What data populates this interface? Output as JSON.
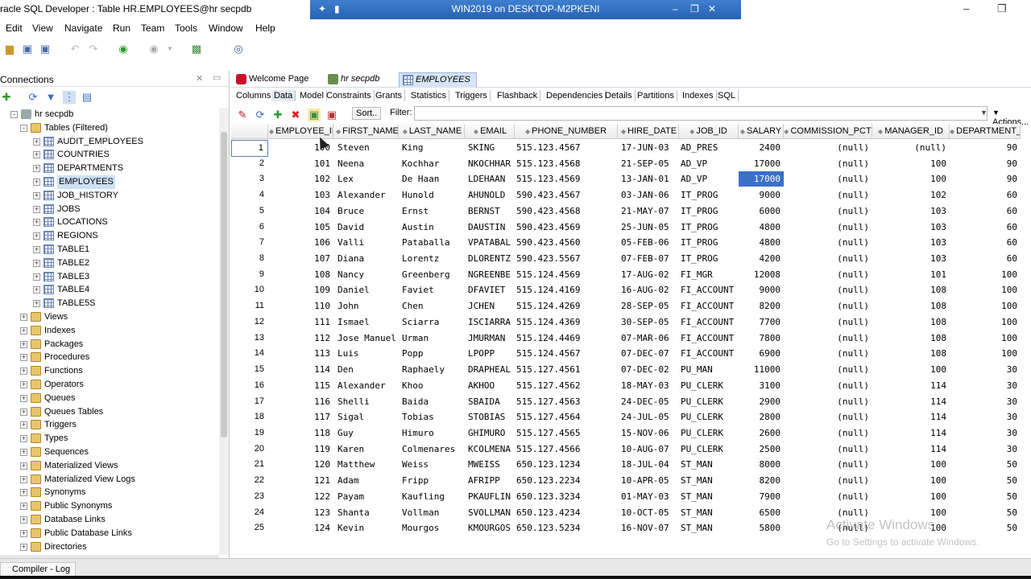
{
  "window": {
    "title": "racle SQL Developer : Table HR.EMPLOYEES@hr secpdb",
    "rdp_title": "WIN2019 on DESKTOP-M2PKENI"
  },
  "menu": [
    "Edit",
    "View",
    "Navigate",
    "Run",
    "Team",
    "Tools",
    "Window",
    "Help"
  ],
  "connections": {
    "title": "Connections",
    "tree": [
      {
        "label": "hr secpdb",
        "level": 0,
        "icon": "db",
        "exp": "-"
      },
      {
        "label": "Tables (Filtered)",
        "level": 1,
        "icon": "folder",
        "exp": "-"
      },
      {
        "label": "AUDIT_EMPLOYEES",
        "level": 2,
        "icon": "table",
        "exp": "+"
      },
      {
        "label": "COUNTRIES",
        "level": 2,
        "icon": "table",
        "exp": "+"
      },
      {
        "label": "DEPARTMENTS",
        "level": 2,
        "icon": "table",
        "exp": "+"
      },
      {
        "label": "EMPLOYEES",
        "level": 2,
        "icon": "table",
        "exp": "+",
        "selected": true
      },
      {
        "label": "JOB_HISTORY",
        "level": 2,
        "icon": "table",
        "exp": "+"
      },
      {
        "label": "JOBS",
        "level": 2,
        "icon": "table",
        "exp": "+"
      },
      {
        "label": "LOCATIONS",
        "level": 2,
        "icon": "table",
        "exp": "+"
      },
      {
        "label": "REGIONS",
        "level": 2,
        "icon": "table",
        "exp": "+"
      },
      {
        "label": "TABLE1",
        "level": 2,
        "icon": "table",
        "exp": "+"
      },
      {
        "label": "TABLE2",
        "level": 2,
        "icon": "table",
        "exp": "+"
      },
      {
        "label": "TABLE3",
        "level": 2,
        "icon": "table",
        "exp": "+"
      },
      {
        "label": "TABLE4",
        "level": 2,
        "icon": "table",
        "exp": "+"
      },
      {
        "label": "TABLE5S",
        "level": 2,
        "icon": "table",
        "exp": "+"
      },
      {
        "label": "Views",
        "level": 1,
        "icon": "folder",
        "exp": "+"
      },
      {
        "label": "Indexes",
        "level": 1,
        "icon": "folder",
        "exp": "+"
      },
      {
        "label": "Packages",
        "level": 1,
        "icon": "folder",
        "exp": "+"
      },
      {
        "label": "Procedures",
        "level": 1,
        "icon": "folder",
        "exp": "+"
      },
      {
        "label": "Functions",
        "level": 1,
        "icon": "folder",
        "exp": "+"
      },
      {
        "label": "Operators",
        "level": 1,
        "icon": "folder",
        "exp": "+"
      },
      {
        "label": "Queues",
        "level": 1,
        "icon": "folder",
        "exp": "+"
      },
      {
        "label": "Queues Tables",
        "level": 1,
        "icon": "folder",
        "exp": "+"
      },
      {
        "label": "Triggers",
        "level": 1,
        "icon": "folder",
        "exp": "+"
      },
      {
        "label": "Types",
        "level": 1,
        "icon": "folder",
        "exp": "+"
      },
      {
        "label": "Sequences",
        "level": 1,
        "icon": "folder",
        "exp": "+"
      },
      {
        "label": "Materialized Views",
        "level": 1,
        "icon": "folder",
        "exp": "+"
      },
      {
        "label": "Materialized View Logs",
        "level": 1,
        "icon": "folder",
        "exp": "+"
      },
      {
        "label": "Synonyms",
        "level": 1,
        "icon": "folder",
        "exp": "+"
      },
      {
        "label": "Public Synonyms",
        "level": 1,
        "icon": "folder",
        "exp": "+"
      },
      {
        "label": "Database Links",
        "level": 1,
        "icon": "folder",
        "exp": "+"
      },
      {
        "label": "Public Database Links",
        "level": 1,
        "icon": "folder",
        "exp": "+"
      },
      {
        "label": "Directories",
        "level": 1,
        "icon": "folder",
        "exp": "+"
      }
    ]
  },
  "doc_tabs": [
    {
      "label": "Welcome Page",
      "icon": "oracle-icon",
      "active": false
    },
    {
      "label": "hr secpdb",
      "icon": "sql-worksheet-icon",
      "active": false
    },
    {
      "label": "EMPLOYEES",
      "icon": "table-icon",
      "active": true
    }
  ],
  "sub_tabs": [
    "Columns",
    "Data",
    "Model",
    "Constraints",
    "Grants",
    "Statistics",
    "Triggers",
    "Flashback",
    "Dependencies",
    "Details",
    "Partitions",
    "Indexes",
    "SQL"
  ],
  "active_sub_tab": "Data",
  "grid_toolbar": {
    "sort_label": "Sort..",
    "filter_label": "Filter:",
    "filter_value": "",
    "actions_label": "Actions..."
  },
  "grid": {
    "columns": [
      "EMPLOYEE_ID",
      "FIRST_NAME",
      "LAST_NAME",
      "EMAIL",
      "PHONE_NUMBER",
      "HIRE_DATE",
      "JOB_ID",
      "SALARY",
      "COMMISSION_PCT",
      "MANAGER_ID",
      "DEPARTMENT_ID"
    ],
    "rows": [
      [
        "1",
        "100",
        "Steven",
        "King",
        "SKING",
        "515.123.4567",
        "17-JUN-03",
        "AD_PRES",
        "2400",
        "(null)",
        "(null)",
        "90"
      ],
      [
        "2",
        "101",
        "Neena",
        "Kochhar",
        "NKOCHHAR",
        "515.123.4568",
        "21-SEP-05",
        "AD_VP",
        "17000",
        "(null)",
        "100",
        "90"
      ],
      [
        "3",
        "102",
        "Lex",
        "De Haan",
        "LDEHAAN",
        "515.123.4569",
        "13-JAN-01",
        "AD_VP",
        "17000",
        "(null)",
        "100",
        "90"
      ],
      [
        "4",
        "103",
        "Alexander",
        "Hunold",
        "AHUNOLD",
        "590.423.4567",
        "03-JAN-06",
        "IT_PROG",
        "9000",
        "(null)",
        "102",
        "60"
      ],
      [
        "5",
        "104",
        "Bruce",
        "Ernst",
        "BERNST",
        "590.423.4568",
        "21-MAY-07",
        "IT_PROG",
        "6000",
        "(null)",
        "103",
        "60"
      ],
      [
        "6",
        "105",
        "David",
        "Austin",
        "DAUSTIN",
        "590.423.4569",
        "25-JUN-05",
        "IT_PROG",
        "4800",
        "(null)",
        "103",
        "60"
      ],
      [
        "7",
        "106",
        "Valli",
        "Pataballa",
        "VPATABAL",
        "590.423.4560",
        "05-FEB-06",
        "IT_PROG",
        "4800",
        "(null)",
        "103",
        "60"
      ],
      [
        "8",
        "107",
        "Diana",
        "Lorentz",
        "DLORENTZ",
        "590.423.5567",
        "07-FEB-07",
        "IT_PROG",
        "4200",
        "(null)",
        "103",
        "60"
      ],
      [
        "9",
        "108",
        "Nancy",
        "Greenberg",
        "NGREENBE",
        "515.124.4569",
        "17-AUG-02",
        "FI_MGR",
        "12008",
        "(null)",
        "101",
        "100"
      ],
      [
        "10",
        "109",
        "Daniel",
        "Faviet",
        "DFAVIET",
        "515.124.4169",
        "16-AUG-02",
        "FI_ACCOUNT",
        "9000",
        "(null)",
        "108",
        "100"
      ],
      [
        "11",
        "110",
        "John",
        "Chen",
        "JCHEN",
        "515.124.4269",
        "28-SEP-05",
        "FI_ACCOUNT",
        "8200",
        "(null)",
        "108",
        "100"
      ],
      [
        "12",
        "111",
        "Ismael",
        "Sciarra",
        "ISCIARRA",
        "515.124.4369",
        "30-SEP-05",
        "FI_ACCOUNT",
        "7700",
        "(null)",
        "108",
        "100"
      ],
      [
        "13",
        "112",
        "Jose Manuel",
        "Urman",
        "JMURMAN",
        "515.124.4469",
        "07-MAR-06",
        "FI_ACCOUNT",
        "7800",
        "(null)",
        "108",
        "100"
      ],
      [
        "14",
        "113",
        "Luis",
        "Popp",
        "LPOPP",
        "515.124.4567",
        "07-DEC-07",
        "FI_ACCOUNT",
        "6900",
        "(null)",
        "108",
        "100"
      ],
      [
        "15",
        "114",
        "Den",
        "Raphaely",
        "DRAPHEAL",
        "515.127.4561",
        "07-DEC-02",
        "PU_MAN",
        "11000",
        "(null)",
        "100",
        "30"
      ],
      [
        "16",
        "115",
        "Alexander",
        "Khoo",
        "AKHOO",
        "515.127.4562",
        "18-MAY-03",
        "PU_CLERK",
        "3100",
        "(null)",
        "114",
        "30"
      ],
      [
        "17",
        "116",
        "Shelli",
        "Baida",
        "SBAIDA",
        "515.127.4563",
        "24-DEC-05",
        "PU_CLERK",
        "2900",
        "(null)",
        "114",
        "30"
      ],
      [
        "18",
        "117",
        "Sigal",
        "Tobias",
        "STOBIAS",
        "515.127.4564",
        "24-JUL-05",
        "PU_CLERK",
        "2800",
        "(null)",
        "114",
        "30"
      ],
      [
        "19",
        "118",
        "Guy",
        "Himuro",
        "GHIMURO",
        "515.127.4565",
        "15-NOV-06",
        "PU_CLERK",
        "2600",
        "(null)",
        "114",
        "30"
      ],
      [
        "20",
        "119",
        "Karen",
        "Colmenares",
        "KCOLMENA",
        "515.127.4566",
        "10-AUG-07",
        "PU_CLERK",
        "2500",
        "(null)",
        "114",
        "30"
      ],
      [
        "21",
        "120",
        "Matthew",
        "Weiss",
        "MWEISS",
        "650.123.1234",
        "18-JUL-04",
        "ST_MAN",
        "8000",
        "(null)",
        "100",
        "50"
      ],
      [
        "22",
        "121",
        "Adam",
        "Fripp",
        "AFRIPP",
        "650.123.2234",
        "10-APR-05",
        "ST_MAN",
        "8200",
        "(null)",
        "100",
        "50"
      ],
      [
        "23",
        "122",
        "Payam",
        "Kaufling",
        "PKAUFLIN",
        "650.123.3234",
        "01-MAY-03",
        "ST_MAN",
        "7900",
        "(null)",
        "100",
        "50"
      ],
      [
        "24",
        "123",
        "Shanta",
        "Vollman",
        "SVOLLMAN",
        "650.123.4234",
        "10-OCT-05",
        "ST_MAN",
        "6500",
        "(null)",
        "100",
        "50"
      ],
      [
        "25",
        "124",
        "Kevin",
        "Mourgos",
        "KMOURGOS",
        "650.123.5234",
        "16-NOV-07",
        "ST_MAN",
        "5800",
        "(null)",
        "100",
        "50"
      ]
    ],
    "selected_cell": {
      "row": 2,
      "col": 8
    }
  },
  "watermark": {
    "line1": "Activate Windows",
    "line2": "Go to Settings to activate Windows."
  },
  "status": {
    "log_tab": "Compiler - Log"
  },
  "colors": {
    "selection": "#3a70c8",
    "active_tab": "#d6e4f5",
    "rdp_bar": "#2f6cc0"
  }
}
